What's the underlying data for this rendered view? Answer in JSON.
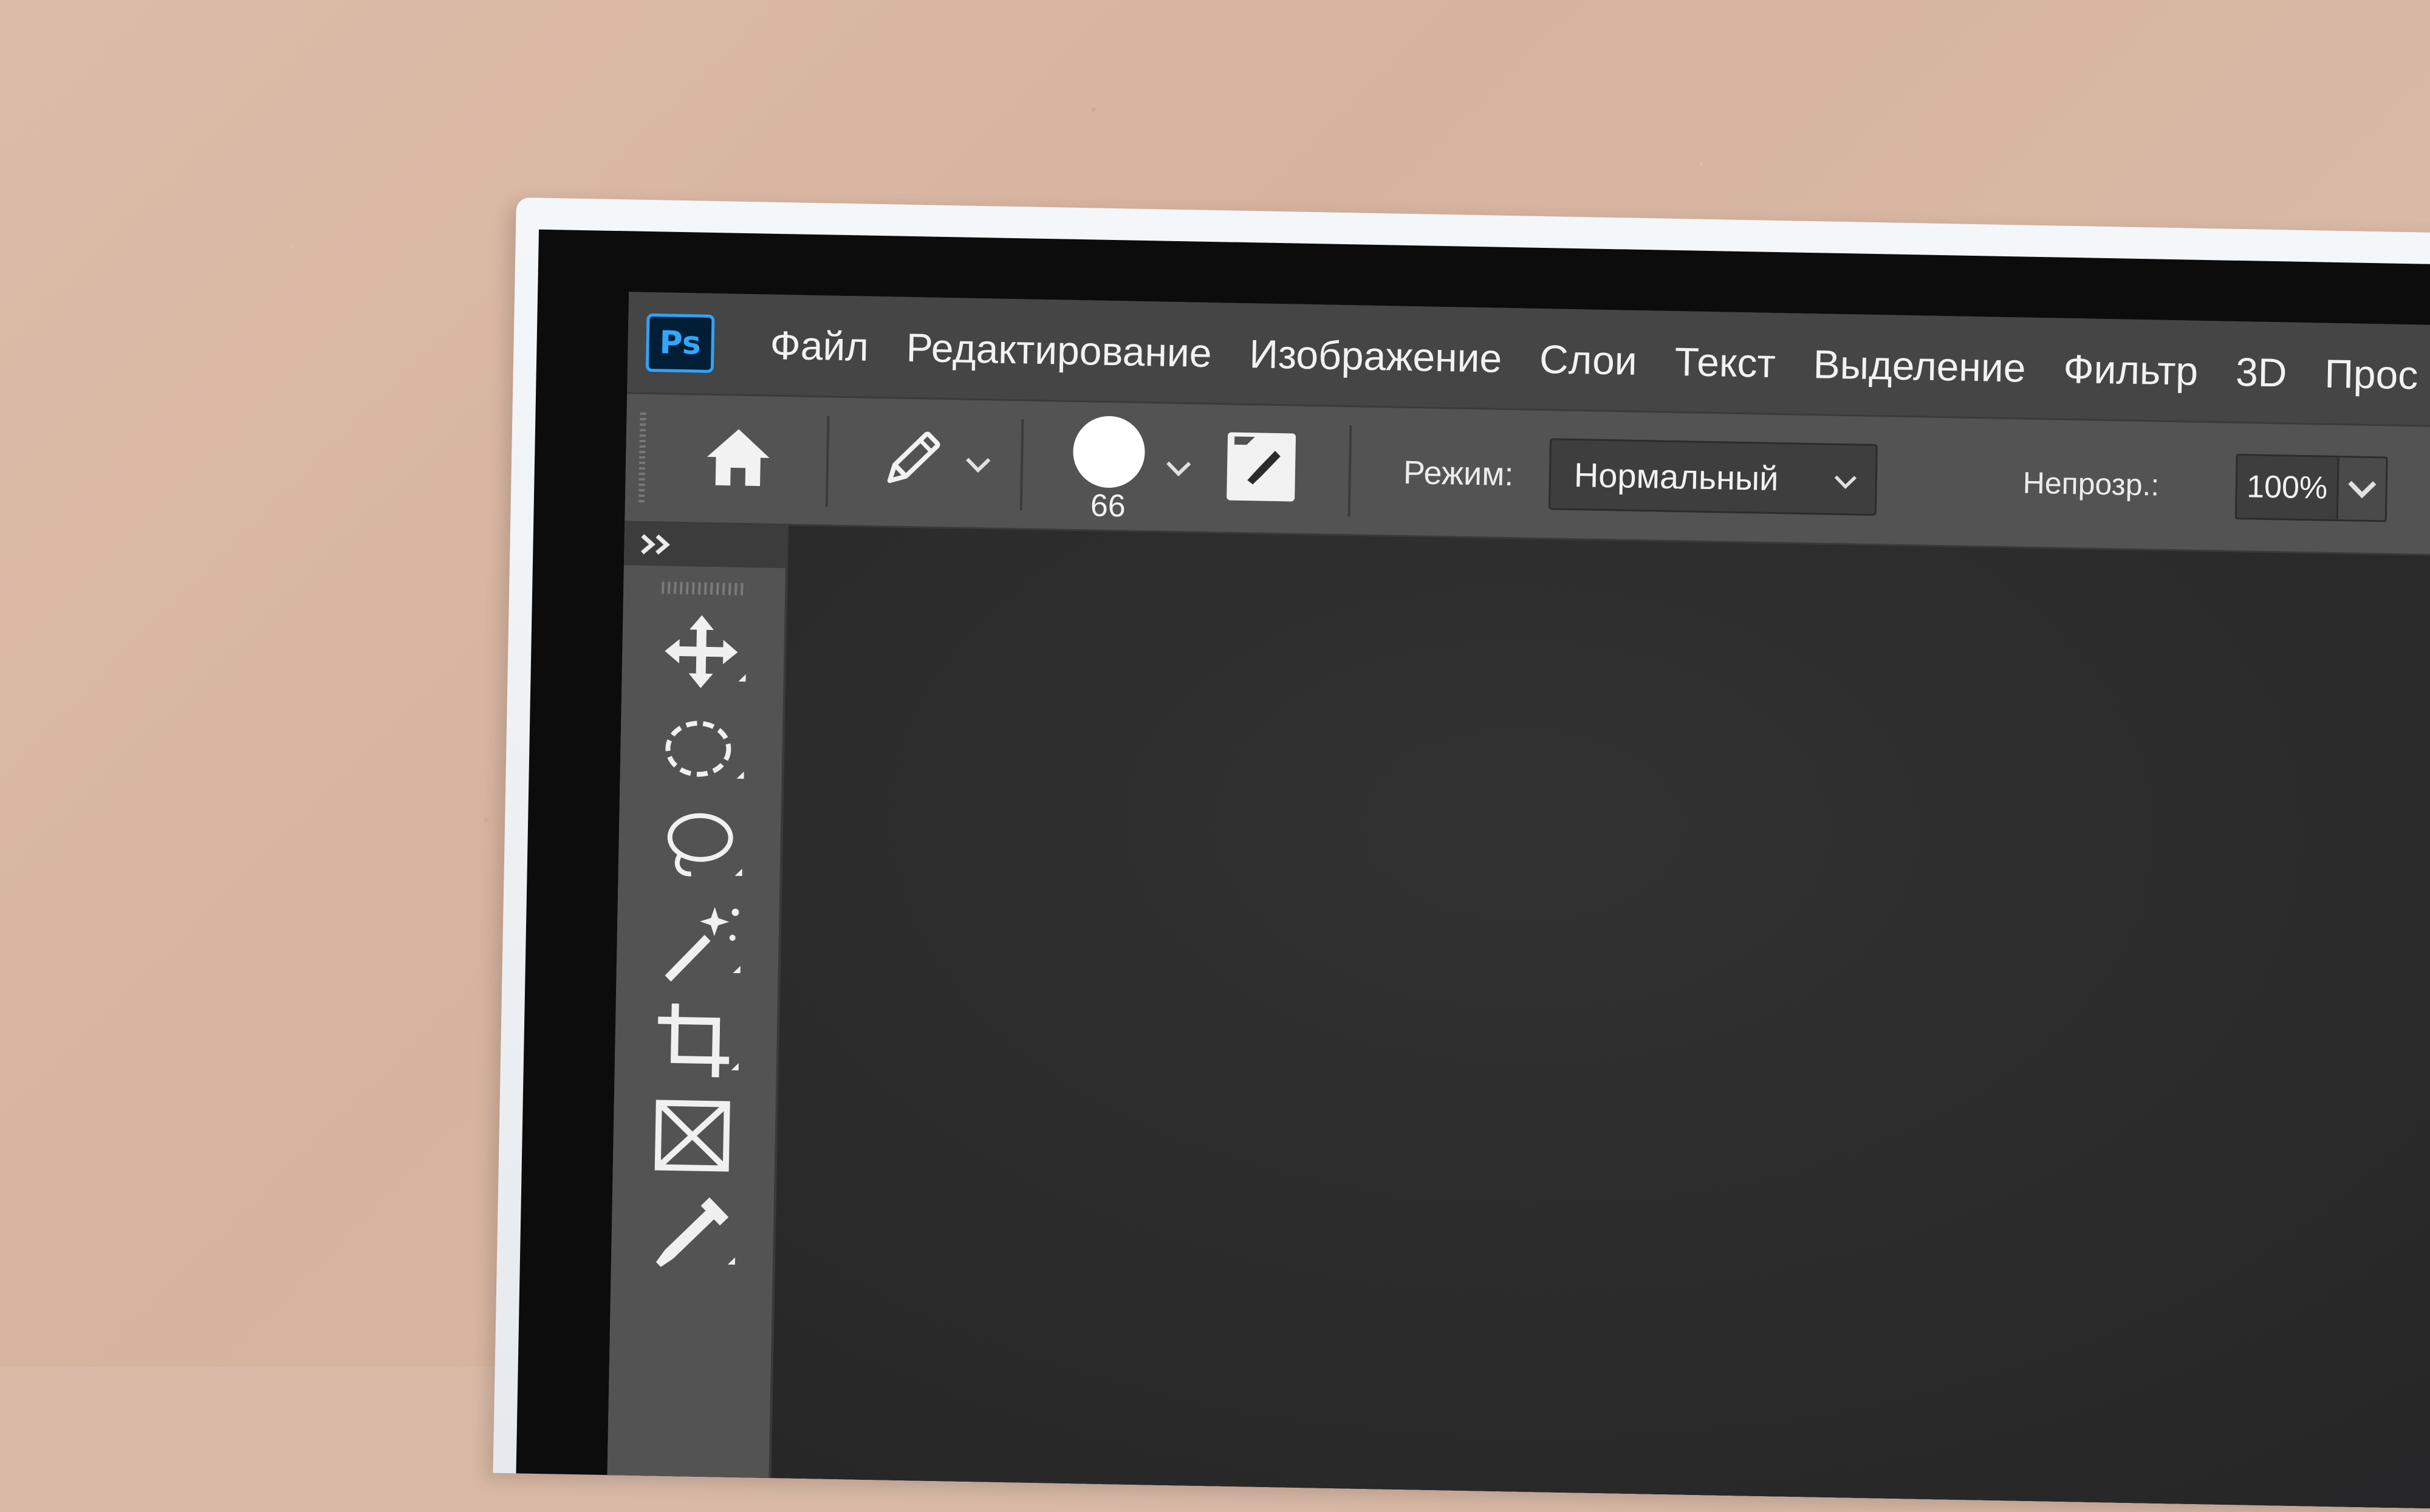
{
  "app": {
    "logo_text": "Ps"
  },
  "menu": {
    "items": [
      "Файл",
      "Редактирование",
      "Изображение",
      "Слои",
      "Текст",
      "Выделение",
      "Фильтр",
      "3D",
      "Прос"
    ]
  },
  "options": {
    "brush_size": "66",
    "mode_label": "Режим:",
    "mode_value": "Нормальный",
    "opacity_label": "Непрозр.:",
    "opacity_value": "100%"
  },
  "icons": {
    "home": "home-icon",
    "pencil": "pencil-icon",
    "brush_panel": "brush-panel-icon",
    "airbrush": "airbrush-icon",
    "expand": "double-chevron-right-icon"
  },
  "tools": [
    {
      "name": "move-tool",
      "icon": "move-icon"
    },
    {
      "name": "marquee-tool",
      "icon": "elliptical-marquee-icon"
    },
    {
      "name": "lasso-tool",
      "icon": "lasso-icon"
    },
    {
      "name": "magic-wand-tool",
      "icon": "magic-wand-icon"
    },
    {
      "name": "crop-tool",
      "icon": "crop-icon"
    },
    {
      "name": "frame-tool",
      "icon": "frame-icon"
    },
    {
      "name": "eyedropper-tool",
      "icon": "eyedropper-icon"
    }
  ],
  "colors": {
    "menubar": "#454545",
    "panel": "#535353",
    "canvas": "#2b2b2b",
    "ps_blue": "#31a8ff",
    "ps_dark": "#001e36"
  }
}
